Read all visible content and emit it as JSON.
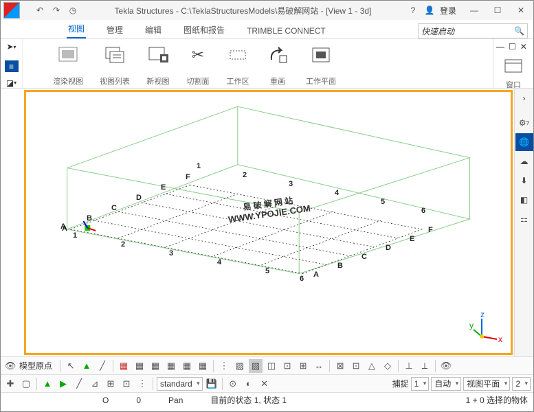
{
  "title": "Tekla Structures - C:\\TeklaStructuresModels\\易破解网站 - [View 1 - 3d]",
  "login_label": "登录",
  "menu": {
    "items": [
      "视图",
      "管理",
      "编辑",
      "图纸和报告",
      "TRIMBLE CONNECT"
    ],
    "active": 0
  },
  "search_placeholder": "快速启动",
  "ribbon": {
    "groups": [
      {
        "label": "渲染视图"
      },
      {
        "label": "视图列表"
      },
      {
        "label": "新视图"
      },
      {
        "label": "切割面"
      },
      {
        "label": "工作区"
      },
      {
        "label": "重画"
      },
      {
        "label": "工作平面"
      },
      {
        "label": "窗口"
      }
    ]
  },
  "grid": {
    "letters": [
      "A",
      "B",
      "C",
      "D",
      "E",
      "F"
    ],
    "numbers": [
      "1",
      "2",
      "3",
      "4",
      "5",
      "6"
    ]
  },
  "watermark": {
    "line1": "易 破 解 网 站",
    "line2": "WWW.YPOJIE.COM"
  },
  "axis": {
    "x": "x",
    "y": "y",
    "z": "z"
  },
  "toolbar2": {
    "model_origin": "模型原点"
  },
  "toolbar3": {
    "standard": "standard",
    "snap": "捕捉",
    "auto": "自动",
    "view_plane": "视图平面",
    "p1": "1",
    "p2": "2"
  },
  "status": {
    "o": "O",
    "zero": "0",
    "pan": "Pan",
    "state": "目前的状态 1, 状态 1",
    "sel": "1 + 0 选择的物体"
  }
}
